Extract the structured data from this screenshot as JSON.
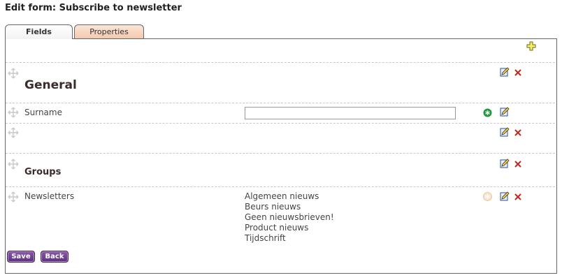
{
  "page": {
    "title": "Edit form: Subscribe to newsletter"
  },
  "tabs": [
    {
      "label": "Fields"
    },
    {
      "label": "Properties"
    }
  ],
  "rows": {
    "general": {
      "heading": "General"
    },
    "surname": {
      "label": "Surname",
      "value": ""
    },
    "groups": {
      "heading": "Groups"
    },
    "newsletters": {
      "label": "Newsletters",
      "options": [
        "Algemeen nieuws",
        "Beurs nieuws",
        "Geen nieuwsbrieven!",
        "Product nieuws",
        "Tijdschrift"
      ]
    }
  },
  "buttons": {
    "save": "Save",
    "back": "Back"
  },
  "colors": {
    "tab_active": "#f3f3f3",
    "tab_inactive": "#f3c9ad",
    "button": "#5e2f7e",
    "required_active": "#1e9a3c",
    "required_inactive": "#f1d3b0"
  },
  "icons": [
    "add-icon",
    "move-icon",
    "edit-icon",
    "delete-icon",
    "required-icon"
  ]
}
